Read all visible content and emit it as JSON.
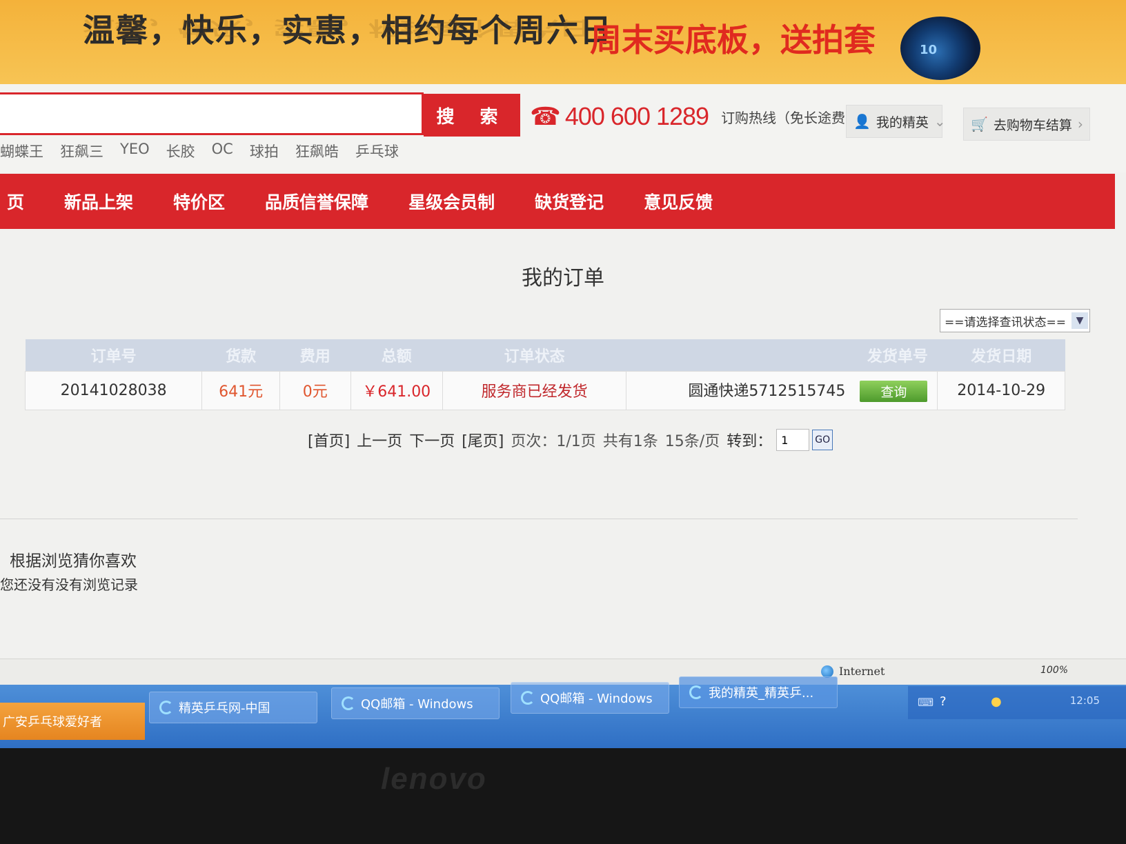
{
  "banner": {
    "slogan": "温馨，快乐，实惠，相约每个周六日",
    "promo": "周末买底板，送拍套",
    "logo_text": "10"
  },
  "search": {
    "placeholder": "",
    "button_label": "搜 索"
  },
  "hotline": {
    "number": "400 600 1289",
    "label": "订购热线（免长途费）"
  },
  "header_links": {
    "account": "我的精英",
    "cart": "去购物车结算"
  },
  "hot_keywords": [
    "蝴蝶王",
    "狂飙三",
    "YEO",
    "长胶",
    "OC",
    "球拍",
    "狂飙皓",
    "乒乓球"
  ],
  "nav": {
    "items": [
      "页",
      "新品上架",
      "特价区",
      "品质信誉保障",
      "星级会员制",
      "缺货登记",
      "意见反馈"
    ]
  },
  "page": {
    "title": "我的订单",
    "status_filter": "==请选择查讯状态=="
  },
  "orders": {
    "headers": [
      "订单号",
      "货款",
      "费用",
      "总额",
      "订单状态",
      "发货单号",
      "发货日期"
    ],
    "rows": [
      {
        "order_no": "20141028038",
        "goods": "641元",
        "fee": "0元",
        "total": "￥641.00",
        "status": "服务商已经发货",
        "shipment": "圆通快递5712515745",
        "track_label": "查询",
        "date": "2014-10-29"
      }
    ]
  },
  "pagination": {
    "first": "[首页]",
    "prev": "上一页",
    "next": "下一页",
    "last": "[尾页]",
    "page_info": "页次：1/1页",
    "total_info": "共有1条",
    "per_page": "15条/页",
    "jump_label": "转到：",
    "jump_value": "1",
    "go_label": "GO"
  },
  "recommend": {
    "title": "根据浏览猜你喜欢",
    "empty": "您还没有没有浏览记录"
  },
  "browser_status": {
    "zone": "Internet",
    "zoom": "100%"
  },
  "taskbar": {
    "start_label": "广安乒乓球爱好者",
    "tasks": [
      "精英乒乓网-中国",
      "QQ邮箱 - Windows",
      "QQ邮箱 - Windows",
      "我的精英_精英乒..."
    ],
    "clock": "12:05"
  },
  "bezel": {
    "brand": "lenovo"
  }
}
